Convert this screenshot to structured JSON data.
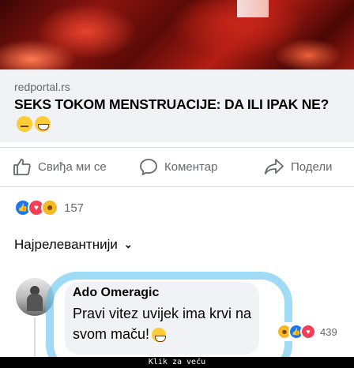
{
  "post": {
    "domain": "redportal.rs",
    "headline": "SEKS TOKOM MENSTRUACIJE: DA ILI IPAK NE?",
    "headline_emojis": [
      "thinking-face-icon",
      "grinning-face-icon"
    ]
  },
  "actions": {
    "like_label": "Свиђа ми се",
    "comment_label": "Коментар",
    "share_label": "Подели"
  },
  "reactions": {
    "types": [
      "like",
      "love",
      "haha"
    ],
    "count": "157"
  },
  "sort": {
    "label": "Најрелевантнији"
  },
  "comment": {
    "author": "Ado Omeragic",
    "text": "Pravi vitez uvijek ima krvi na svom maču!",
    "reaction_types": [
      "haha",
      "like",
      "love"
    ],
    "reaction_count": "439"
  },
  "caption": "Klik za veću",
  "colors": {
    "fb_blue": "#1877f2",
    "text_primary": "#050505",
    "text_secondary": "#65676b",
    "highlight": "#50beeb"
  }
}
